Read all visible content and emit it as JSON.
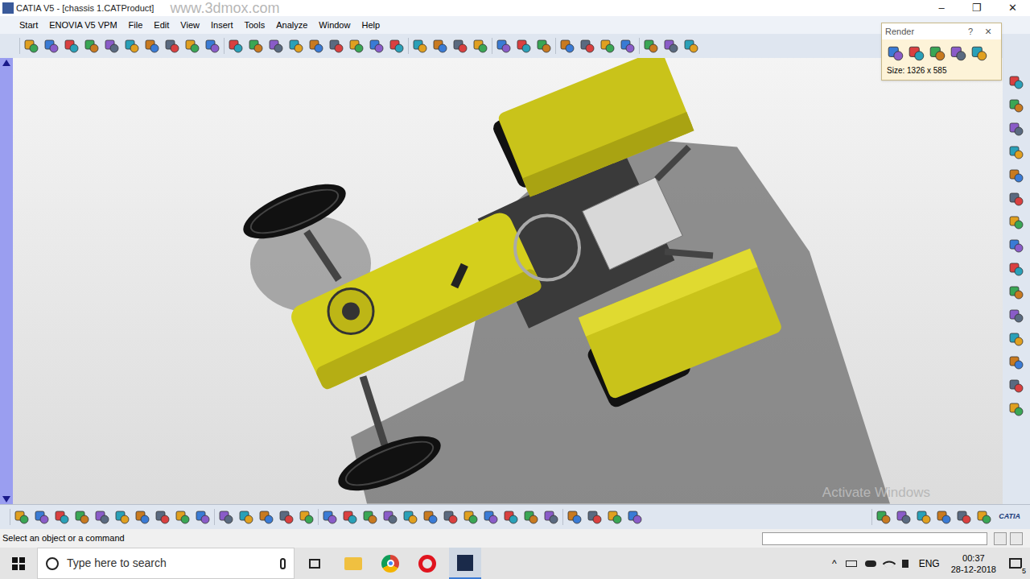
{
  "window": {
    "title": "CATIA V5 - [chassis 1.CATProduct]",
    "controls": [
      "–",
      "❐",
      "✕"
    ],
    "watermark": "www.3dmox.com"
  },
  "menu": [
    "Start",
    "ENOVIA V5 VPM",
    "File",
    "Edit",
    "View",
    "Insert",
    "Tools",
    "Analyze",
    "Window",
    "Help"
  ],
  "render_panel": {
    "title": "Render",
    "help": "?",
    "close": "×",
    "size": "Size: 1326 x 585"
  },
  "viewport": {
    "watermark": "Activate Windows"
  },
  "catia_logo": "CATIA",
  "status_bar": {
    "message": "Select an object or a command"
  },
  "taskbar": {
    "search_placeholder": "Type here to search",
    "language": "ENG",
    "time": "00:37",
    "date": "28-12-2018",
    "notifications": "5"
  }
}
